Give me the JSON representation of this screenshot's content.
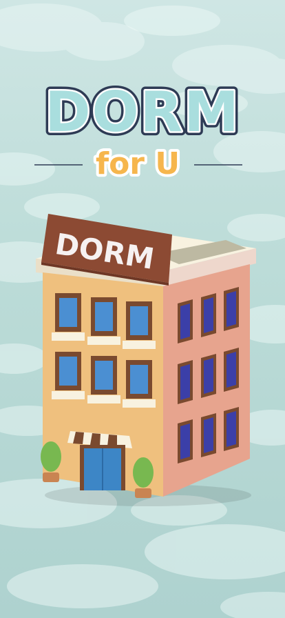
{
  "title": {
    "main": "DORM",
    "sub": "for U"
  },
  "building": {
    "sign_text": "DORM"
  },
  "colors": {
    "background": "#b7dbd7",
    "title_fill": "#a9dede",
    "title_outline": "#2e3b55",
    "sub_fill": "#f6b64d",
    "sub_outline": "#ffffff",
    "sign_bg": "#8c4a33",
    "front_wall": "#efc07e",
    "side_wall": "#e7a48e",
    "window_blue": "#4b8fd2",
    "window_frame": "#7a4a2f",
    "door": "#3d86c6",
    "awning_stripe": "#7a4a2f",
    "plant": "#78b850"
  }
}
